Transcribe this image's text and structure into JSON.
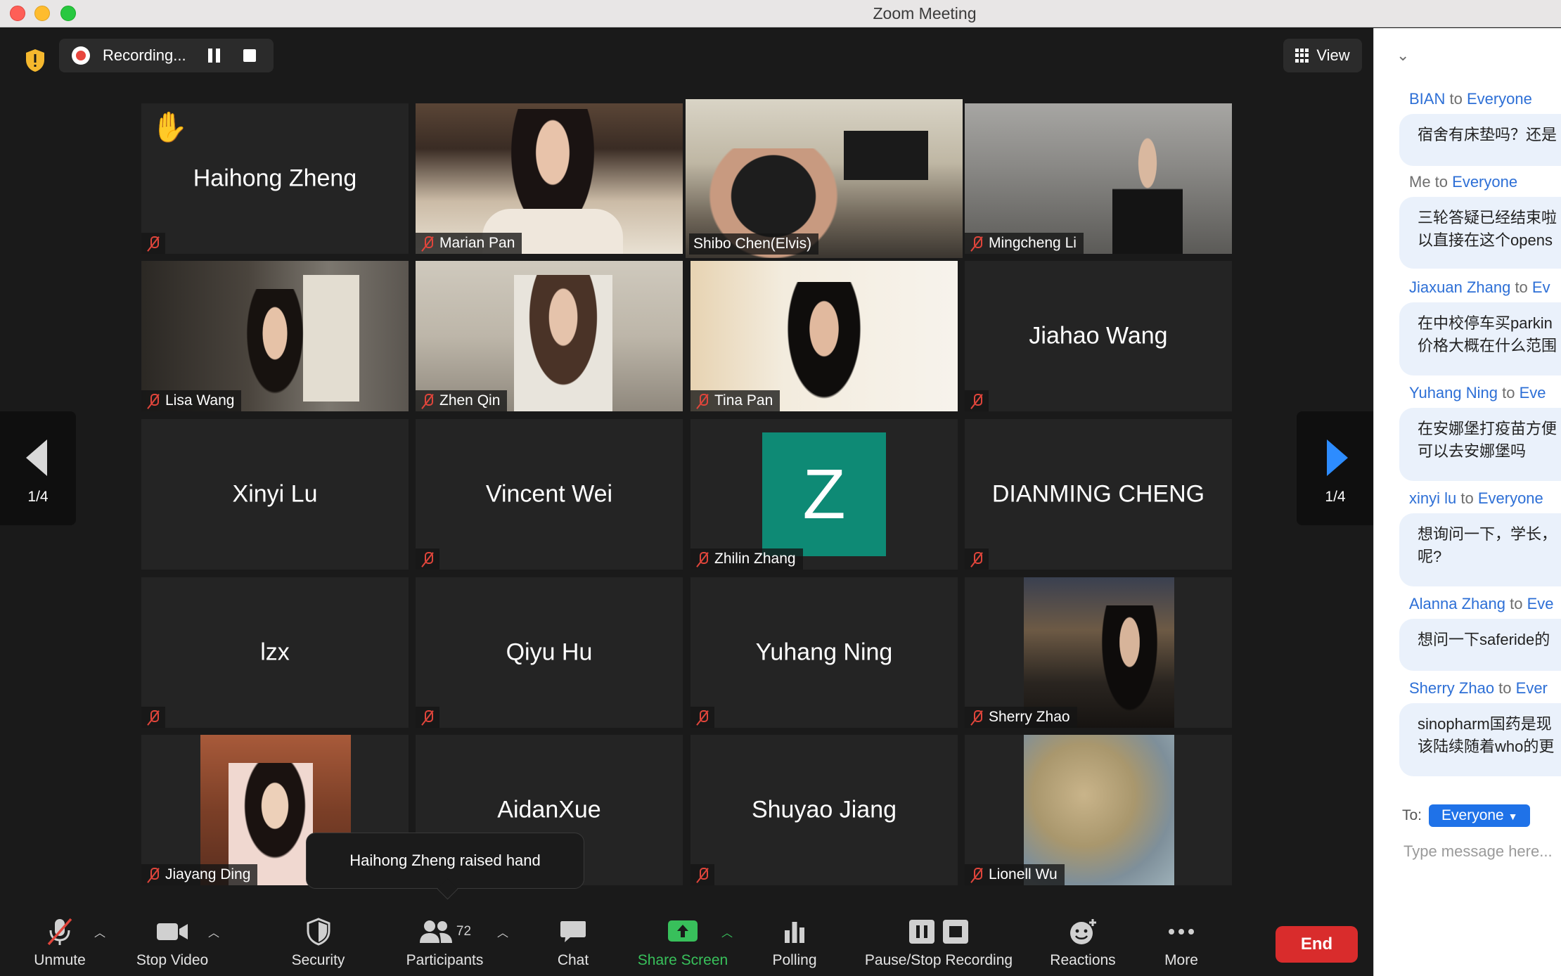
{
  "window": {
    "title": "Zoom Meeting"
  },
  "top": {
    "recording_label": "Recording...",
    "view_label": "View"
  },
  "pager": {
    "left": "1/4",
    "right": "1/4"
  },
  "tiles": [
    {
      "name": "Haihong Zheng",
      "kind": "name",
      "hand": true
    },
    {
      "name": "Marian Pan",
      "kind": "video"
    },
    {
      "name": "Shibo Chen(Elvis)",
      "kind": "video",
      "active": true
    },
    {
      "name": "Mingcheng Li",
      "kind": "video"
    },
    {
      "name": "Lisa Wang",
      "kind": "video"
    },
    {
      "name": "Zhen Qin",
      "kind": "video"
    },
    {
      "name": "Tina Pan",
      "kind": "video"
    },
    {
      "name": "Jiahao Wang",
      "kind": "name"
    },
    {
      "name": "Xinyi Lu",
      "kind": "name"
    },
    {
      "name": "Vincent Wei",
      "kind": "name"
    },
    {
      "name": "Zhilin Zhang",
      "kind": "avatar",
      "initial": "Z"
    },
    {
      "name": "DIANMING CHENG",
      "kind": "name"
    },
    {
      "name": "lzx",
      "kind": "name"
    },
    {
      "name": "Qiyu Hu",
      "kind": "name"
    },
    {
      "name": "Yuhang Ning",
      "kind": "name"
    },
    {
      "name": "Sherry Zhao",
      "kind": "video"
    },
    {
      "name": "Jiayang Ding",
      "kind": "video"
    },
    {
      "name": "AidanXue",
      "kind": "name"
    },
    {
      "name": "Shuyao Jiang",
      "kind": "name"
    },
    {
      "name": "Lionell Wu",
      "kind": "video"
    }
  ],
  "toast": {
    "text": "Haihong Zheng raised hand"
  },
  "toolbar": {
    "unmute": "Unmute",
    "stop_video": "Stop Video",
    "security": "Security",
    "participants": "Participants",
    "participants_count": "72",
    "chat": "Chat",
    "share_screen": "Share Screen",
    "polling": "Polling",
    "pause_stop_recording": "Pause/Stop Recording",
    "reactions": "Reactions",
    "more": "More",
    "end": "End"
  },
  "chat": {
    "messages": [
      {
        "from": "BIAN",
        "to": "Everyone",
        "text": [
          "宿舍有床垫吗？还是"
        ]
      },
      {
        "from": "Me",
        "to": "Everyone",
        "self": true,
        "text": [
          "三轮答疑已经结束啦",
          "以直接在这个opens"
        ]
      },
      {
        "from": "Jiaxuan Zhang",
        "to": "Ev",
        "text": [
          "在中校停车买parkin",
          "价格大概在什么范围"
        ]
      },
      {
        "from": "Yuhang Ning",
        "to": "Eve",
        "text": [
          "在安娜堡打疫苗方便",
          "可以去安娜堡吗"
        ]
      },
      {
        "from": "xinyi lu",
        "to": "Everyone",
        "text": [
          "想询问一下，学长，",
          "呢?"
        ]
      },
      {
        "from": "Alanna Zhang",
        "to": "Eve",
        "text": [
          "想问一下saferide的"
        ]
      },
      {
        "from": "Sherry Zhao",
        "to": "Ever",
        "text": [
          "sinopharm国药是现",
          "该陆续随着who的更"
        ]
      }
    ],
    "to_label": "To:",
    "to_value": "Everyone",
    "placeholder": "Type message here..."
  },
  "colors": {
    "accent": "#2d8cff",
    "active_speaker": "#b8e04a",
    "end": "#d92c2c",
    "share": "#38c05b",
    "mute": "#e0453b"
  }
}
